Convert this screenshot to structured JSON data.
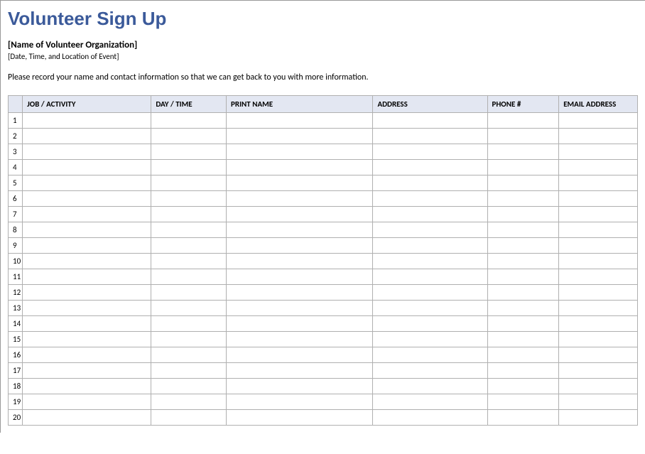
{
  "title": "Volunteer Sign Up",
  "organization": "[Name of Volunteer Organization]",
  "event_line": "[Date, Time, and Location of Event]",
  "instructions": "Please record your name and contact information so that we can get back to you with more information.",
  "columns": {
    "job": "JOB / ACTIVITY",
    "day": "DAY / TIME",
    "name": "PRINT NAME",
    "address": "ADDRESS",
    "phone": "PHONE #",
    "email": "EMAIL ADDRESS"
  },
  "rows": [
    {
      "n": "1",
      "job": "",
      "day": "",
      "name": "",
      "address": "",
      "phone": "",
      "email": ""
    },
    {
      "n": "2",
      "job": "",
      "day": "",
      "name": "",
      "address": "",
      "phone": "",
      "email": ""
    },
    {
      "n": "3",
      "job": "",
      "day": "",
      "name": "",
      "address": "",
      "phone": "",
      "email": ""
    },
    {
      "n": "4",
      "job": "",
      "day": "",
      "name": "",
      "address": "",
      "phone": "",
      "email": ""
    },
    {
      "n": "5",
      "job": "",
      "day": "",
      "name": "",
      "address": "",
      "phone": "",
      "email": ""
    },
    {
      "n": "6",
      "job": "",
      "day": "",
      "name": "",
      "address": "",
      "phone": "",
      "email": ""
    },
    {
      "n": "7",
      "job": "",
      "day": "",
      "name": "",
      "address": "",
      "phone": "",
      "email": ""
    },
    {
      "n": "8",
      "job": "",
      "day": "",
      "name": "",
      "address": "",
      "phone": "",
      "email": ""
    },
    {
      "n": "9",
      "job": "",
      "day": "",
      "name": "",
      "address": "",
      "phone": "",
      "email": ""
    },
    {
      "n": "10",
      "job": "",
      "day": "",
      "name": "",
      "address": "",
      "phone": "",
      "email": ""
    },
    {
      "n": "11",
      "job": "",
      "day": "",
      "name": "",
      "address": "",
      "phone": "",
      "email": ""
    },
    {
      "n": "12",
      "job": "",
      "day": "",
      "name": "",
      "address": "",
      "phone": "",
      "email": ""
    },
    {
      "n": "13",
      "job": "",
      "day": "",
      "name": "",
      "address": "",
      "phone": "",
      "email": ""
    },
    {
      "n": "14",
      "job": "",
      "day": "",
      "name": "",
      "address": "",
      "phone": "",
      "email": ""
    },
    {
      "n": "15",
      "job": "",
      "day": "",
      "name": "",
      "address": "",
      "phone": "",
      "email": ""
    },
    {
      "n": "16",
      "job": "",
      "day": "",
      "name": "",
      "address": "",
      "phone": "",
      "email": ""
    },
    {
      "n": "17",
      "job": "",
      "day": "",
      "name": "",
      "address": "",
      "phone": "",
      "email": ""
    },
    {
      "n": "18",
      "job": "",
      "day": "",
      "name": "",
      "address": "",
      "phone": "",
      "email": ""
    },
    {
      "n": "19",
      "job": "",
      "day": "",
      "name": "",
      "address": "",
      "phone": "",
      "email": ""
    },
    {
      "n": "20",
      "job": "",
      "day": "",
      "name": "",
      "address": "",
      "phone": "",
      "email": ""
    }
  ]
}
